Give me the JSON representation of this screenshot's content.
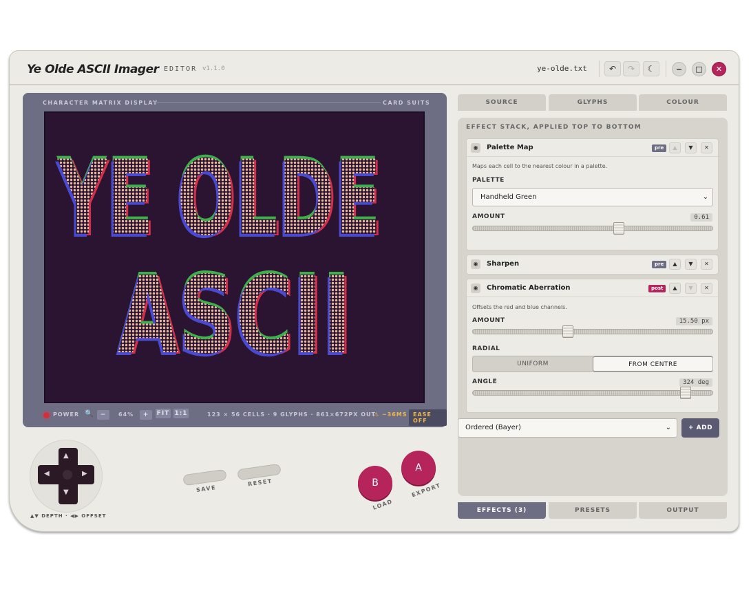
{
  "titlebar": {
    "title": "Ye Olde ASCII Imager",
    "subtitle": "EDITOR",
    "version": "v1.1.0",
    "filename": "ye-olde.txt",
    "undo_icon": "↶",
    "redo_icon": "↷",
    "theme_icon": "☾",
    "minimize_icon": "−",
    "maximize_icon": "□",
    "close_icon": "✕"
  },
  "display": {
    "label": "CHARACTER MATRIX DISPLAY",
    "glyph_set": "CARD SUITS",
    "art_line1": "YE OLDE",
    "art_line2": "ASCII",
    "colors": {
      "background": "#2a1432",
      "fill": "#e8b89a",
      "red": "#d0304a",
      "green": "#3fae4c",
      "blue": "#4a4ad0"
    }
  },
  "status": {
    "power": "POWER",
    "zoom_minus": "−",
    "zoom": "64%",
    "zoom_plus": "+",
    "fit": "FIT",
    "one_to_one": "1:1",
    "info": "123 × 56 CELLS · 9 GLYPHS · 861×672PX OUT",
    "timing": "⚠ ~36MS",
    "ease": "EASE OFF"
  },
  "controls": {
    "dpad_caption": "▲▼ DEPTH · ◀▶ OFFSET",
    "up": "▲",
    "down": "▼",
    "left": "◀",
    "right": "▶",
    "save": "SAVE",
    "reset": "RESET",
    "b_button": "B",
    "b_label": "LOAD",
    "a_button": "A",
    "a_label": "EXPORT"
  },
  "top_tabs": [
    "SOURCE",
    "GLYPHS",
    "COLOUR"
  ],
  "bottom_tabs": [
    "EFFECTS (3)",
    "PRESETS",
    "OUTPUT"
  ],
  "effects": {
    "heading": "EFFECT STACK, APPLIED TOP TO BOTTOM",
    "palette_map": {
      "name": "Palette Map",
      "badge": "pre",
      "description": "Maps each cell to the nearest colour in a palette.",
      "palette_label": "PALETTE",
      "palette_value": "Handheld Green",
      "amount_label": "AMOUNT",
      "amount_value": "0.61",
      "amount_fraction": 0.61
    },
    "sharpen": {
      "name": "Sharpen",
      "badge": "pre"
    },
    "chromatic": {
      "name": "Chromatic Aberration",
      "badge": "post",
      "description": "Offsets the red and blue channels.",
      "amount_label": "AMOUNT",
      "amount_value": "15.50 px",
      "amount_fraction": 0.39,
      "radial_label": "RADIAL",
      "radial_options": [
        "UNIFORM",
        "FROM CENTRE"
      ],
      "angle_label": "ANGLE",
      "angle_value": "324 deg",
      "angle_fraction": 0.9
    },
    "add_select": "Ordered (Bayer)",
    "add_button": "+ ADD"
  }
}
